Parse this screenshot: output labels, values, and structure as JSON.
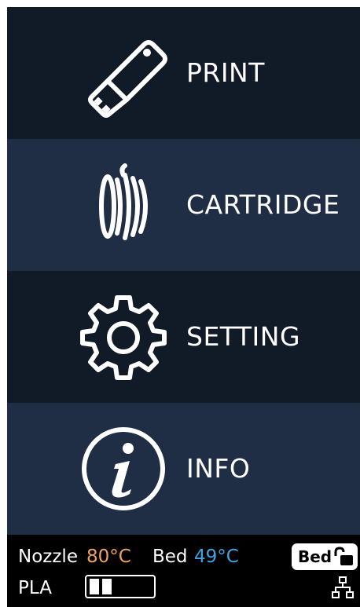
{
  "menu": {
    "items": [
      {
        "label": "PRINT",
        "icon": "usb-drive-icon"
      },
      {
        "label": "CARTRIDGE",
        "icon": "filament-spool-icon"
      },
      {
        "label": "SETTING",
        "icon": "gear-icon"
      },
      {
        "label": "INFO",
        "icon": "info-icon"
      }
    ]
  },
  "status": {
    "nozzle_label": "Nozzle",
    "nozzle_temp": "80°C",
    "bed_label": "Bed",
    "bed_temp": "49°C",
    "bed_button_label": "Bed",
    "bed_lock_icon": "unlock-icon",
    "material": "PLA",
    "filament_level": 0.25,
    "network_icon": "network-icon"
  },
  "colors": {
    "dark_row": "#111a27",
    "light_row": "#1f2e45",
    "nozzle_temp": "#f0a35c",
    "bed_temp": "#3ea4e3"
  }
}
